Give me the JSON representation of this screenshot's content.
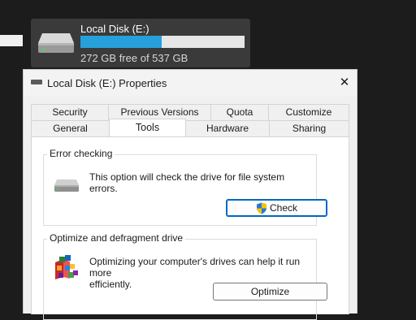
{
  "drive_tile": {
    "name": "Local Disk (E:)",
    "usage_fraction": 0.494,
    "free_text": "272 GB free of 537 GB",
    "icon": "hard-drive-icon"
  },
  "window": {
    "title": "Local Disk (E:) Properties",
    "close_label": "✕",
    "tabs_back": [
      "Security",
      "Previous Versions",
      "Quota",
      "Customize"
    ],
    "tabs_front": [
      "General",
      "Tools",
      "Hardware",
      "Sharing"
    ],
    "active_tab": "Tools"
  },
  "error_checking": {
    "title": "Error checking",
    "description_line1": "This option will check the drive for file system",
    "description_line2": "errors.",
    "button_label": "Check",
    "icon": "hard-drive-icon",
    "button_icon": "shield-icon"
  },
  "optimize": {
    "title": "Optimize and defragment drive",
    "description_line1": "Optimizing your computer's drives can help it run more",
    "description_line2": "efficiently.",
    "button_label": "Optimize",
    "icon": "defragment-icon"
  },
  "colors": {
    "accent": "#0067c0",
    "progress": "#26a0da",
    "tile_bg": "#3a3a3a",
    "desktop_bg": "#1c1c1c"
  }
}
